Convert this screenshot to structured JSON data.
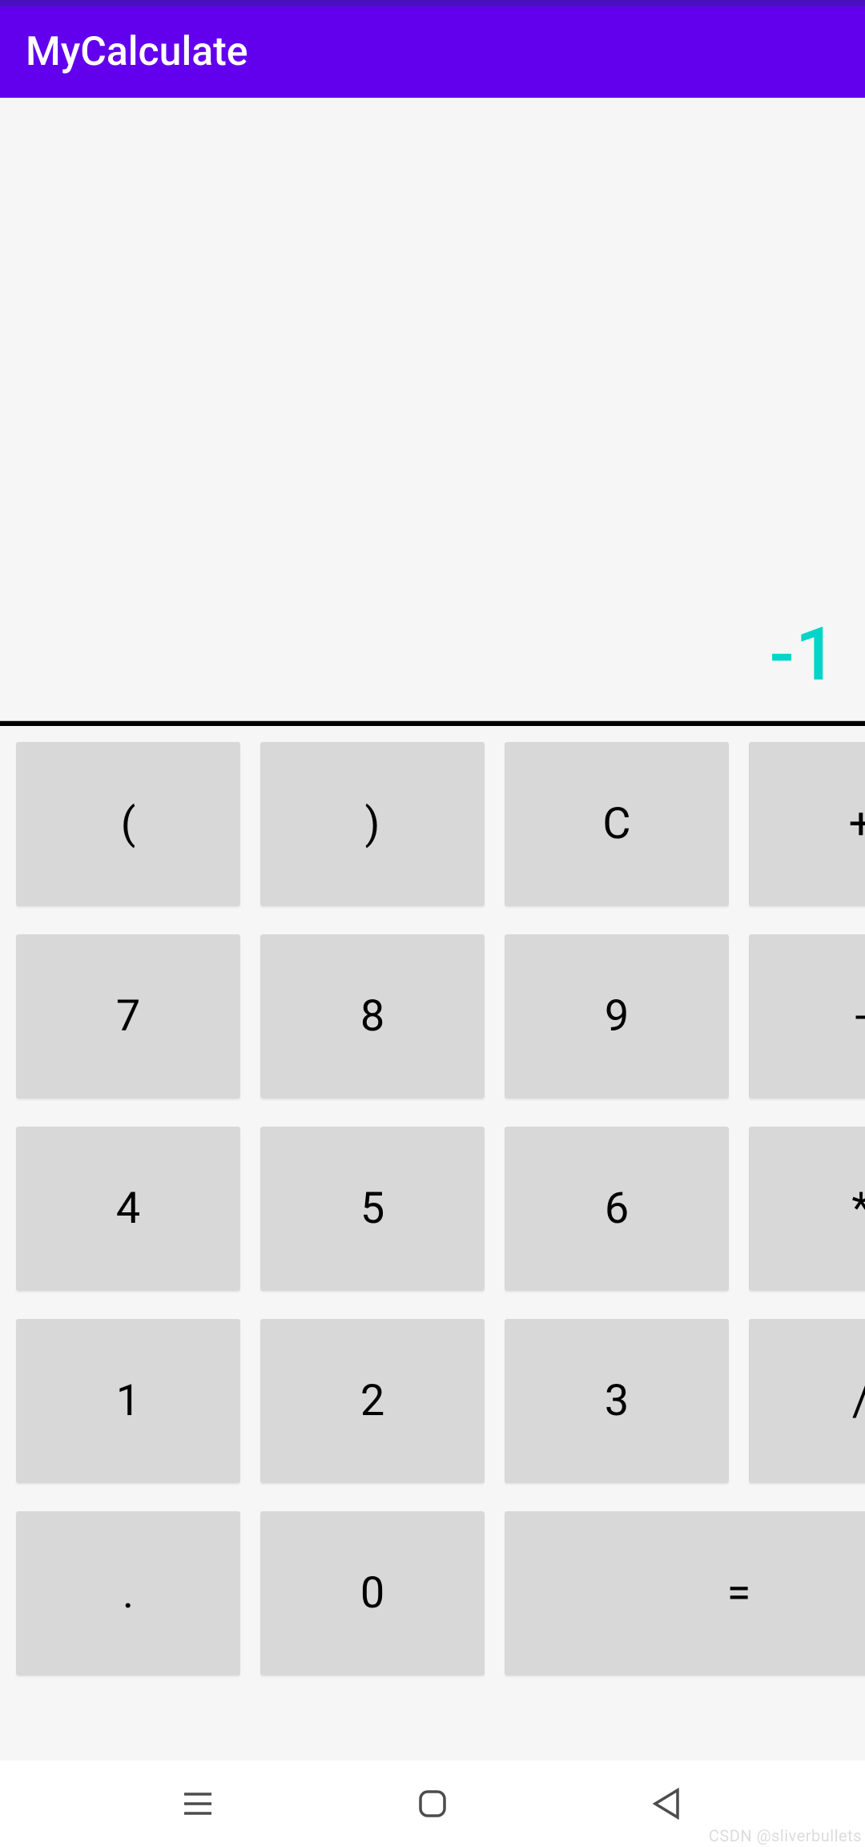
{
  "app": {
    "title": "MyCalculate"
  },
  "display": {
    "value": "-1"
  },
  "keys": {
    "lparen": "(",
    "rparen": ")",
    "clear": "C",
    "plus": "+",
    "n7": "7",
    "n8": "8",
    "n9": "9",
    "minus": "-",
    "n4": "4",
    "n5": "5",
    "n6": "6",
    "mult": "*",
    "n1": "1",
    "n2": "2",
    "n3": "3",
    "div": "/",
    "dot": ".",
    "n0": "0",
    "eq": "="
  },
  "footer": {
    "watermark": "CSDN @sliverbullets"
  }
}
